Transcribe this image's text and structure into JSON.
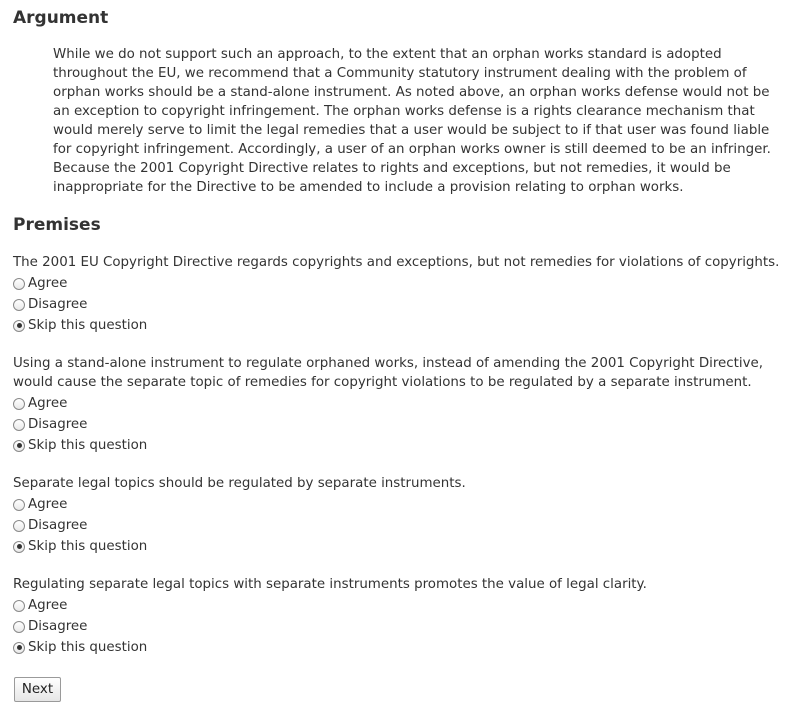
{
  "argument": {
    "title": "Argument",
    "text": "While we do not support such an approach, to the extent that an orphan works standard is adopted throughout the EU, we recommend that a Community statutory instrument dealing with the problem of orphan works should be a stand-alone instrument. As noted above, an orphan works defense would not be an exception to copyright infringement. The orphan works defense is a rights clearance mechanism that would merely serve to limit the legal remedies that a user would be subject to if that user was found liable for copyright infringement. Accordingly, a user of an orphan works owner is still deemed to be an infringer. Because the 2001 Copyright Directive relates to rights and exceptions, but not remedies, it would be inappropriate for the Directive to be amended to include a provision relating to orphan works."
  },
  "premises": {
    "title": "Premises",
    "questions": [
      {
        "text": "The 2001 EU Copyright Directive regards copyrights and exceptions, but not remedies for violations of copyrights.",
        "options": [
          "Agree",
          "Disagree",
          "Skip this question"
        ],
        "selected": "Skip this question"
      },
      {
        "text": "Using a stand-alone instrument to regulate orphaned works, instead of amending the 2001 Copyright Directive, would cause the separate topic of remedies for copyright violations to be regulated by a separate instrument.",
        "options": [
          "Agree",
          "Disagree",
          "Skip this question"
        ],
        "selected": "Skip this question"
      },
      {
        "text": "Separate legal topics should be regulated by separate instruments.",
        "options": [
          "Agree",
          "Disagree",
          "Skip this question"
        ],
        "selected": "Skip this question"
      },
      {
        "text": "Regulating separate legal topics with separate instruments promotes the value of legal clarity.",
        "options": [
          "Agree",
          "Disagree",
          "Skip this question"
        ],
        "selected": "Skip this question"
      }
    ]
  },
  "next_label": "Next"
}
